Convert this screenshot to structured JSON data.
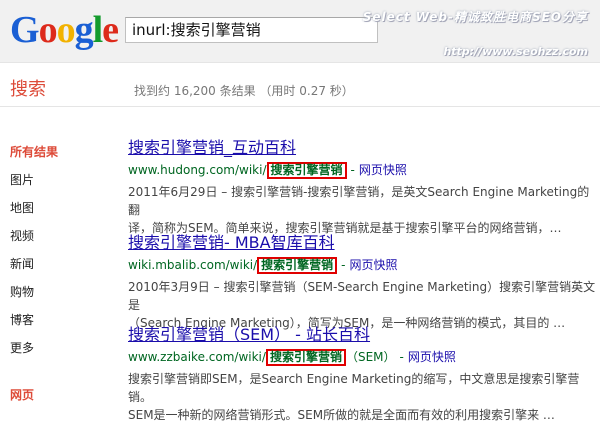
{
  "header": {
    "logo_letters": [
      {
        "ch": "G",
        "color": "#1a5fd4"
      },
      {
        "ch": "o",
        "color": "#dd2a1b"
      },
      {
        "ch": "o",
        "color": "#f2b200"
      },
      {
        "ch": "g",
        "color": "#1a5fd4"
      },
      {
        "ch": "l",
        "color": "#149b2d"
      },
      {
        "ch": "e",
        "color": "#dd2a1b"
      }
    ],
    "search_value": "inurl:搜索引擎营销",
    "watermark_line1": "Select Web-精诚致胜电商SEO分享",
    "watermark_line2": "http://www.seohzz.com"
  },
  "bar": {
    "title": "搜索",
    "stats": "找到约 16,200 条结果 （用时 0.27 秒）"
  },
  "nav": {
    "items": [
      "所有结果",
      "图片",
      "地图",
      "视频",
      "新闻",
      "购物",
      "博客",
      "更多"
    ],
    "web_label": "网页"
  },
  "results": [
    {
      "title": "搜索引擎营销_互动百科",
      "url": "www.hudong.com/wiki/",
      "url_highlight": "搜索引擎营销",
      "url_after": "",
      "cache": "网页快照",
      "snippet_line1": "2011年6月29日 – 搜索引擎营销-搜索引擎营销，是英文Search Engine Marketing的翻",
      "snippet_line2": "译，简称为SEM。简单来说，搜索引擎营销就是基于搜索引擎平台的网络营销，…"
    },
    {
      "title": "搜索引擎营销- MBA智库百科",
      "url": "wiki.mbalib.com/wiki/",
      "url_highlight": "搜索引擎营销",
      "url_after": "",
      "cache": "网页快照",
      "snippet_line1": "2010年3月9日 – 搜索引擎营销（SEM-Search Engine Marketing）搜索引擎营销英文是",
      "snippet_line2": "（Search Engine Marketing），简写为SEM，是一种网络营销的模式，其目的 …"
    },
    {
      "title": "搜索引擎营销（SEM） - 站长百科",
      "url": "www.zzbaike.com/wiki/",
      "url_highlight": "搜索引擎营销",
      "url_after": "（SEM）",
      "cache": "网页快照",
      "snippet_line1": "搜索引擎营销即SEM，是Search Engine Marketing的缩写，中文意思是搜索引擎营销。",
      "snippet_line2": "SEM是一种新的网络营销形式。SEM所做的就是全面而有效的利用搜索引擎来 …"
    }
  ]
}
